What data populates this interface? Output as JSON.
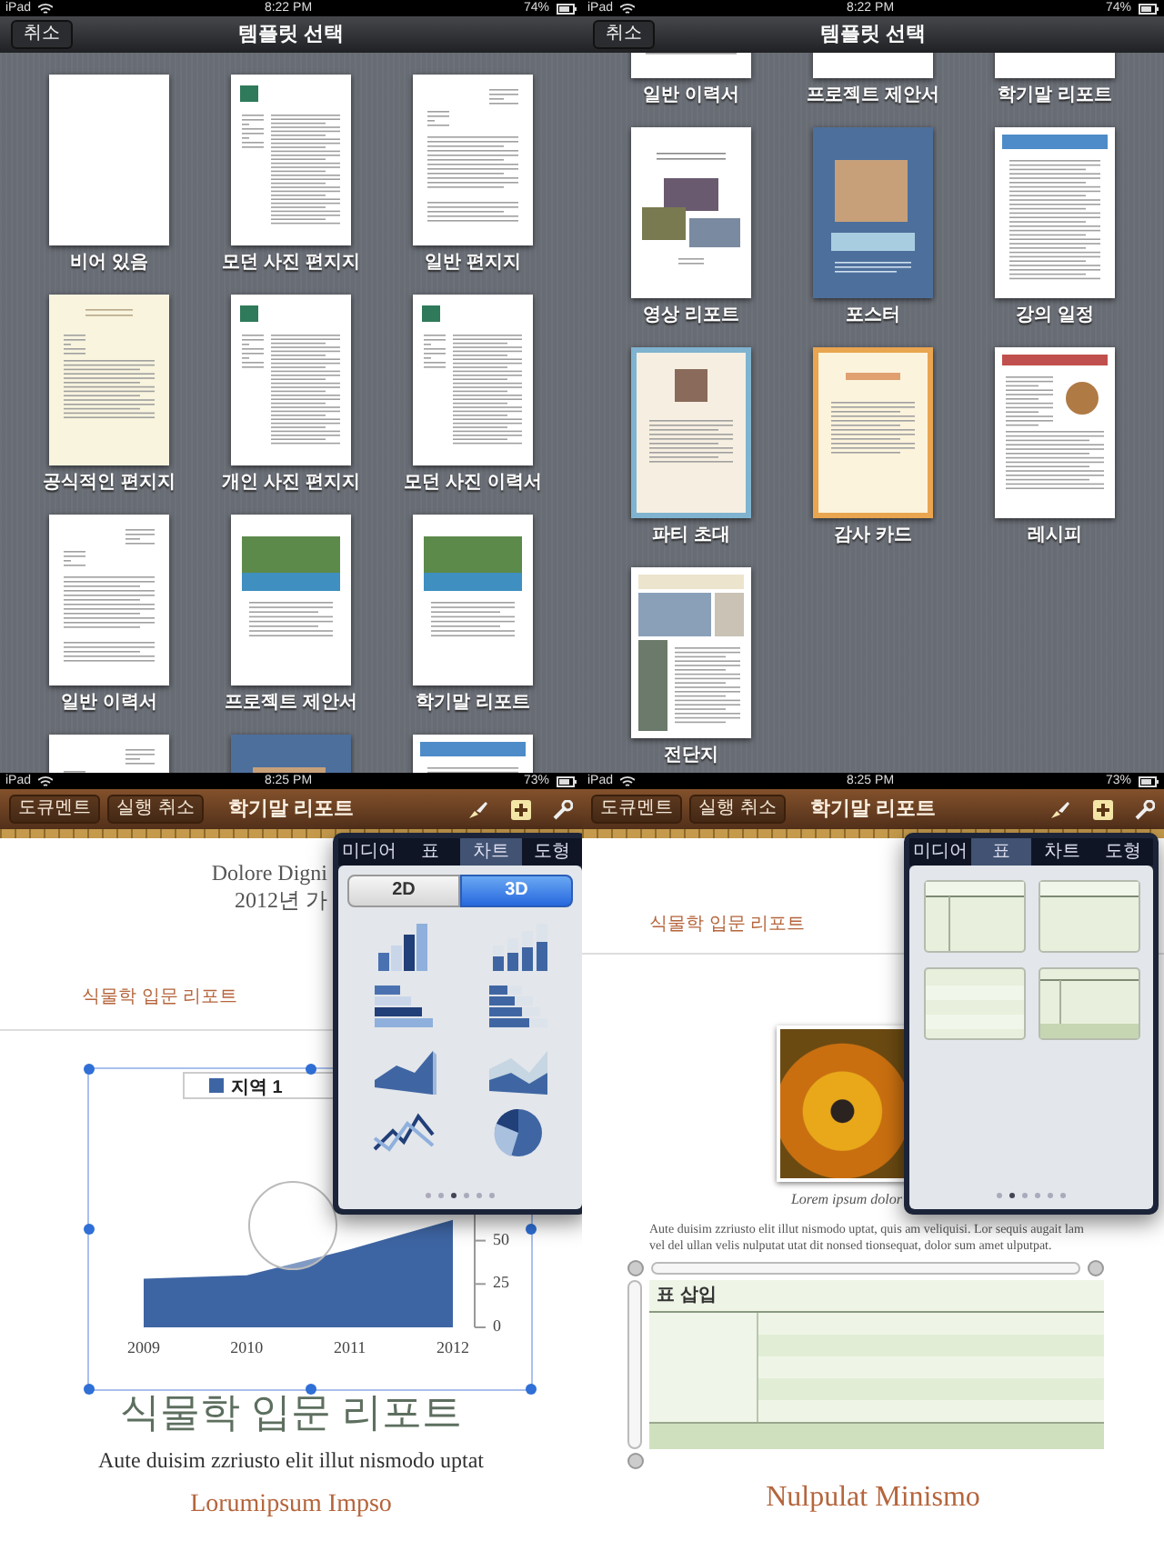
{
  "template_screens": [
    {
      "status_bar": {
        "device": "iPad",
        "time": "8:22 PM",
        "battery": "74%"
      },
      "cancel_button": "취소",
      "title": "템플릿 선택",
      "scrolled": false,
      "templates": [
        {
          "label": "비어 있음",
          "kind": "blank"
        },
        {
          "label": "모던 사진 편지지",
          "kind": "photo-letter"
        },
        {
          "label": "일반 편지지",
          "kind": "letter"
        },
        {
          "label": "공식적인 편지지",
          "kind": "cream-letter"
        },
        {
          "label": "개인 사진 편지지",
          "kind": "photo-letter"
        },
        {
          "label": "모던 사진 이력서",
          "kind": "photo-letter"
        },
        {
          "label": "일반 이력서",
          "kind": "letter"
        },
        {
          "label": "프로젝트 제안서",
          "kind": "photo-report"
        },
        {
          "label": "학기말 리포트",
          "kind": "photo-report"
        },
        {
          "kind": "letter"
        },
        {
          "kind": "poster"
        },
        {
          "kind": "banner"
        }
      ]
    },
    {
      "status_bar": {
        "device": "iPad",
        "time": "8:22 PM",
        "battery": "74%"
      },
      "cancel_button": "취소",
      "title": "템플릿 선택",
      "scrolled": true,
      "templates": [
        {
          "label": "일반 이력서",
          "kind": "letter"
        },
        {
          "label": "프로젝트 제안서",
          "kind": "photo-report"
        },
        {
          "label": "학기말 리포트",
          "kind": "photo-report"
        },
        {
          "label": "영상 리포트",
          "kind": "collage"
        },
        {
          "label": "포스터",
          "kind": "poster"
        },
        {
          "label": "강의 일정",
          "kind": "banner"
        },
        {
          "label": "파티 초대",
          "kind": "party"
        },
        {
          "label": "감사 카드",
          "kind": "card"
        },
        {
          "label": "레시피",
          "kind": "recipe"
        },
        {
          "label": "전단지",
          "kind": "flyer"
        }
      ]
    }
  ],
  "editor_screens": [
    {
      "status_bar": {
        "device": "iPad",
        "time": "8:25 PM",
        "battery": "73%"
      },
      "document_button": "도큐멘트",
      "undo_button": "실행 취소",
      "title": "학기말 리포트",
      "popover": {
        "kind": "chart",
        "tabs": [
          {
            "label": "미디어",
            "selected": false
          },
          {
            "label": "표",
            "selected": false
          },
          {
            "label": "차트",
            "selected": true
          },
          {
            "label": "도형",
            "selected": false
          }
        ],
        "segments": [
          {
            "label": "2D",
            "selected": false
          },
          {
            "label": "3D",
            "selected": true
          }
        ],
        "items": [
          {
            "kind": "bar"
          },
          {
            "kind": "stacked-bar"
          },
          {
            "kind": "horizontal-bar"
          },
          {
            "kind": "stacked-horizontal-bar"
          },
          {
            "kind": "area"
          },
          {
            "kind": "stacked-area"
          },
          {
            "kind": "line"
          },
          {
            "kind": "pie"
          }
        ],
        "pages": [
          {
            "selected": false
          },
          {
            "selected": false
          },
          {
            "selected": true
          },
          {
            "selected": false
          },
          {
            "selected": false
          },
          {
            "selected": false
          }
        ]
      },
      "document": {
        "kind": "chart-page",
        "heading_lines": [
          "Dolore Digni",
          "2012년 가"
        ],
        "header_note": "식물학 입문 리포트",
        "chart_data": {
          "type": "area",
          "categories": [
            "2009",
            "2010",
            "2011",
            "2012"
          ],
          "series": [
            {
              "name": "지역 1",
              "color": "#3e65a3",
              "values": [
                28,
                30,
                45,
                62
              ]
            }
          ],
          "yticks": [
            0,
            25,
            50
          ],
          "ylim": [
            0,
            65
          ]
        },
        "title": "식물학 입문 리포트",
        "subtitle": "Aute duisim zzriusto elit illut nismodo uptat",
        "author": "Lorumipsum Impso"
      }
    },
    {
      "status_bar": {
        "device": "iPad",
        "time": "8:25 PM",
        "battery": "73%"
      },
      "document_button": "도큐멘트",
      "undo_button": "실행 취소",
      "title": "학기말 리포트",
      "popover": {
        "kind": "table",
        "tabs": [
          {
            "label": "미디어",
            "selected": false
          },
          {
            "label": "표",
            "selected": true
          },
          {
            "label": "차트",
            "selected": false
          },
          {
            "label": "도형",
            "selected": false
          }
        ],
        "items": [
          {
            "kind": "header-column"
          },
          {
            "kind": "header-row"
          },
          {
            "kind": "plain"
          },
          {
            "kind": "header-column-footer"
          }
        ],
        "pages": [
          {
            "selected": false
          },
          {
            "selected": true
          },
          {
            "selected": false
          },
          {
            "selected": false
          },
          {
            "selected": false
          },
          {
            "selected": false
          }
        ]
      },
      "document": {
        "kind": "table-page",
        "header_note": "식물학 입문 리포트",
        "caption": "Lorem ipsum dolor",
        "paragraph": "Aute duisim zzriusto elit illut nismodo uptat, quis am veliquisi. Lor sequis augait lam vel del ullan velis nulputat utat dit nonsed tionsequat, dolor sum amet ulputpat.",
        "table_title": "표 삽입",
        "footer_heading": "Nulpulat Minismo"
      }
    }
  ]
}
